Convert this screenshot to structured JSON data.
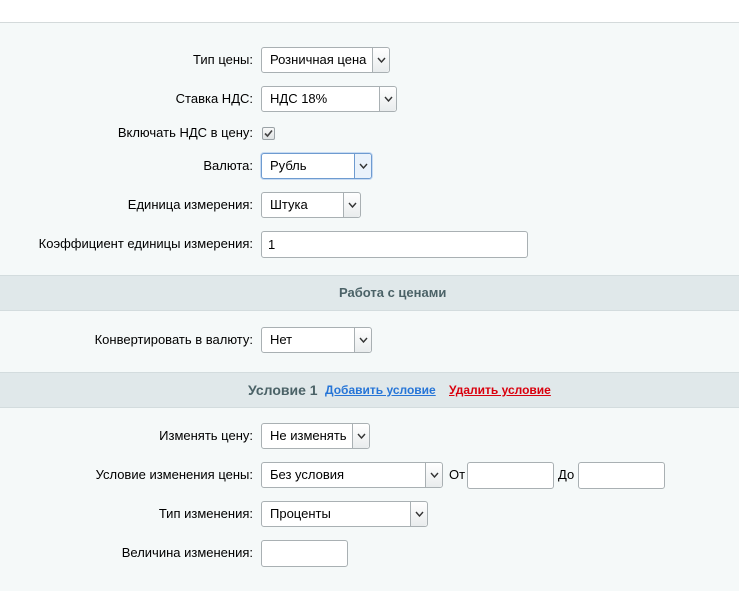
{
  "price_type": {
    "label": "Тип цены:",
    "value": "Розничная цена"
  },
  "vat_rate": {
    "label": "Ставка НДС:",
    "value": "НДС 18%"
  },
  "include_vat": {
    "label": "Включать НДС в цену:",
    "checked": true
  },
  "currency": {
    "label": "Валюта:",
    "value": "Рубль"
  },
  "unit": {
    "label": "Единица измерения:",
    "value": "Штука"
  },
  "unit_coef": {
    "label": "Коэффициент единицы измерения:",
    "value": "1"
  },
  "prices_section": {
    "title": "Работа с ценами"
  },
  "convert_currency": {
    "label": "Конвертировать в валюту:",
    "value": "Нет"
  },
  "condition_section": {
    "title": "Условие 1",
    "add_link": "Добавить условие",
    "delete_link": "Удалить условие"
  },
  "change_price": {
    "label": "Изменять цену:",
    "value": "Не изменять"
  },
  "price_condition": {
    "label": "Условие изменения цены:",
    "value": "Без условия",
    "from_label": "От",
    "from_value": "",
    "to_label": "До",
    "to_value": ""
  },
  "change_type": {
    "label": "Тип изменения:",
    "value": "Проценты"
  },
  "change_amount": {
    "label": "Величина изменения:",
    "value": ""
  },
  "colors": {
    "link_add": "#2675d7",
    "link_delete": "#d9000d",
    "section_bg": "#e0e8ea",
    "page_bg": "#f5f9f9"
  }
}
